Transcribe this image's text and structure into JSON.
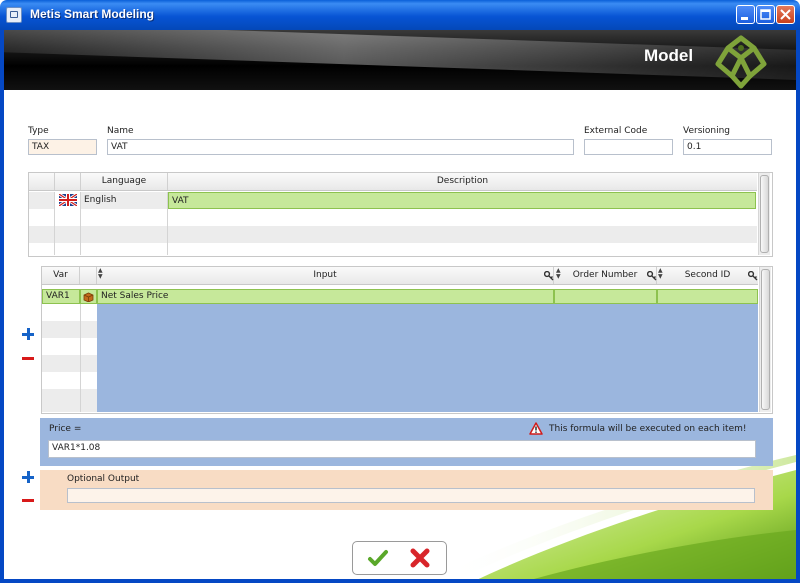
{
  "window": {
    "title": "Metis Smart Modeling"
  },
  "banner": {
    "title": "Model"
  },
  "form": {
    "type": {
      "label": "Type",
      "value": "TAX"
    },
    "name": {
      "label": "Name",
      "value": "VAT"
    },
    "external_code": {
      "label": "External Code",
      "value": ""
    },
    "versioning": {
      "label": "Versioning",
      "value": "0.1"
    }
  },
  "language_table": {
    "columns": [
      "Language",
      "Description"
    ],
    "rows": [
      {
        "language": "English",
        "description": "VAT",
        "flag": "uk-flag-icon"
      }
    ]
  },
  "var_table": {
    "columns": [
      "Var",
      "Input",
      "Order Number",
      "Second ID"
    ],
    "rows": [
      {
        "var": "VAR1",
        "input": "Net Sales Price",
        "order_number": "",
        "second_id": "",
        "icon": "box-icon"
      }
    ]
  },
  "formula": {
    "label": "Price =",
    "warning": "This formula will be executed on each item!",
    "value": "VAR1*1.08"
  },
  "optional_output": {
    "label": "Optional Output",
    "value": ""
  },
  "colors": {
    "accent_blue": "#0754d4",
    "row_highlight": "#c6e89a",
    "formula_bg": "#9bb6de",
    "optional_bg": "#f8dcc4",
    "logo_green": "#6b8f2e"
  }
}
